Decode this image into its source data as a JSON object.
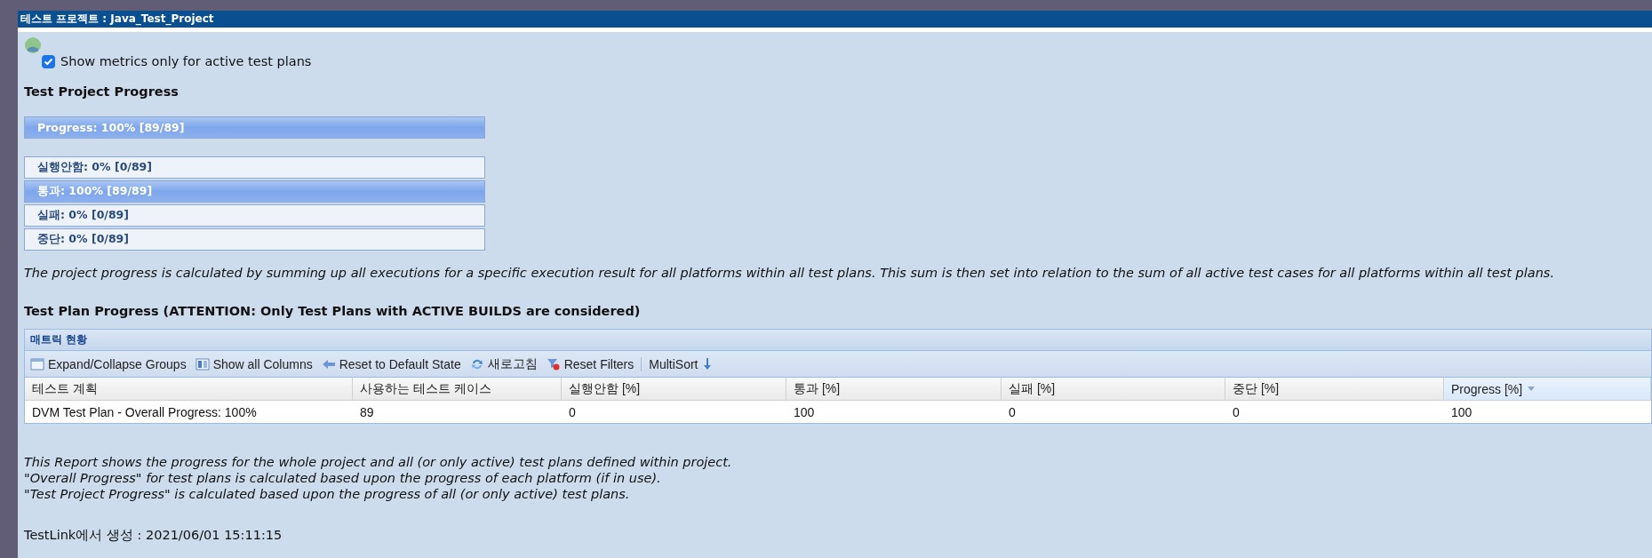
{
  "window": {
    "title": "테스트 프로젝트 : Java_Test_Project"
  },
  "active_only": {
    "label": "Show metrics only for active test plans",
    "checked": true
  },
  "project_progress": {
    "heading": "Test Project Progress",
    "total": {
      "label": "Progress: 100% [89/89]",
      "level": 1
    },
    "statuses": [
      {
        "label": "실행안함: 0% [0/89]",
        "level": 0
      },
      {
        "label": "통과: 100% [89/89]",
        "level": 1
      },
      {
        "label": "실패: 0% [0/89]",
        "level": 0
      },
      {
        "label": "중단: 0% [0/89]",
        "level": 0
      }
    ]
  },
  "note": "The project progress is calculated by summing up all executions for a specific execution result for all platforms within all test plans. This sum is then set into relation to the sum of all active test cases for all platforms within all test plans.",
  "plan_heading": "Test Plan Progress (ATTENTION: Only Test Plans with ACTIVE BUILDS are considered)",
  "grid": {
    "title": "매트릭 현황",
    "toolbar": [
      {
        "label": "Expand/Collapse Groups",
        "kind": "expand"
      },
      {
        "label": "Show all Columns",
        "kind": "columns"
      },
      {
        "label": "Reset to Default State",
        "kind": "reset"
      },
      {
        "label": "새로고침",
        "kind": "refresh"
      },
      {
        "label": "Reset Filters",
        "kind": "filters"
      },
      {
        "label": "MultiSort",
        "kind": "multisort"
      }
    ],
    "columns": [
      {
        "label": "테스트 계획",
        "sorted": false
      },
      {
        "label": "사용하는 테스트 케이스",
        "sorted": false
      },
      {
        "label": "실행안함 [%]",
        "sorted": false
      },
      {
        "label": "통과 [%]",
        "sorted": false
      },
      {
        "label": "실패 [%]",
        "sorted": false
      },
      {
        "label": "중단 [%]",
        "sorted": false
      },
      {
        "label": "Progress [%]",
        "sorted": true
      }
    ],
    "rows": [
      [
        "DVM Test Plan - Overall Progress: 100%",
        "89",
        "0",
        "100",
        "0",
        "0",
        "100"
      ]
    ]
  },
  "footnotes": [
    "This Report shows the progress for the whole project and all (or only active) test plans defined within project.",
    "\"Overall Progress\" for test plans is calculated based upon the progress of each platform (if in use).",
    "\"Test Project Progress\" is calculated based upon the progress of all (or only active) test plans."
  ],
  "generated": "TestLink에서 생성 : 2021/06/01 15:11:15"
}
